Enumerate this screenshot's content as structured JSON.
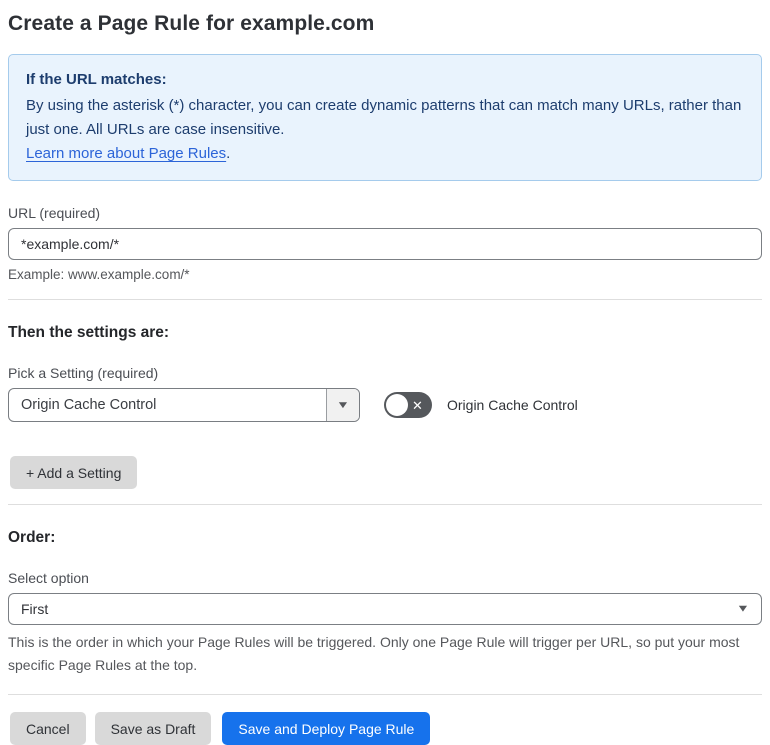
{
  "page": {
    "title": "Create a Page Rule for example.com"
  },
  "info_box": {
    "heading": "If the URL matches:",
    "body": "By using the asterisk (*) character, you can create dynamic patterns that can match many URLs, rather than just one. All URLs are case insensitive.",
    "link_text": "Learn more about Page Rules",
    "link_suffix": "."
  },
  "url_field": {
    "label": "URL (required)",
    "value": "*example.com/*",
    "helper": "Example: www.example.com/*"
  },
  "settings_section": {
    "heading": "Then the settings are:",
    "pick_label": "Pick a Setting (required)",
    "selected_setting": "Origin Cache Control",
    "toggle_state": "off",
    "toggle_label": "Origin Cache Control",
    "add_button_label": "+ Add a Setting"
  },
  "order_section": {
    "heading": "Order:",
    "select_label": "Select option",
    "selected_option": "First",
    "helper": "This is the order in which your Page Rules will be triggered. Only one Page Rule will trigger per URL, so put your most specific Page Rules at the top."
  },
  "footer": {
    "cancel_label": "Cancel",
    "save_draft_label": "Save as Draft",
    "save_deploy_label": "Save and Deploy Page Rule"
  },
  "icons": {
    "dropdown_caret": "▼",
    "toggle_off_x": "✕"
  },
  "colors": {
    "accent_blue": "#1672ec",
    "info_bg": "#e9f3fd",
    "info_border": "#a5cbec",
    "info_text": "#1d3d6e",
    "link_blue": "#2c64d8",
    "button_gray": "#d9d9d9",
    "toggle_off_bg": "#55585c"
  }
}
